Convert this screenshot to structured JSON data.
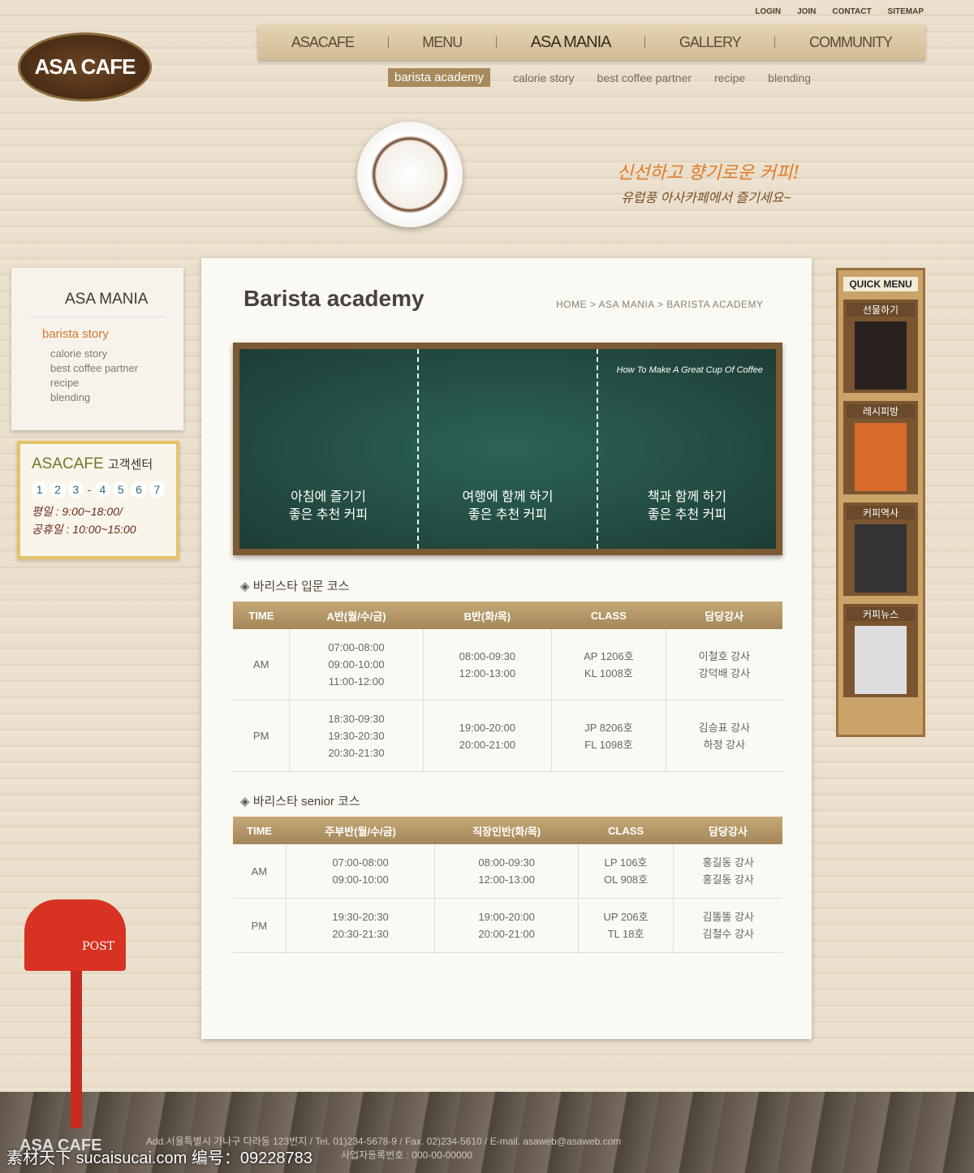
{
  "top_links": [
    "LOGIN",
    "JOIN",
    "CONTACT",
    "SITEMAP"
  ],
  "logo": "ASA CAFE",
  "nav": [
    "ASACAFE",
    "MENU",
    "ASA MANIA",
    "GALLERY",
    "COMMUNITY"
  ],
  "nav_active": "ASA MANIA",
  "subnav": [
    "barista academy",
    "calorie story",
    "best coffee partner",
    "recipe",
    "blending"
  ],
  "slogan": "신선하고 향기로운 커피!",
  "slogan2": "유럽풍 아사카페에서 즐기세요~",
  "sidebar": {
    "title": "ASA MANIA",
    "items": [
      "barista story",
      "calorie story",
      "best coffee partner",
      "recipe",
      "blending"
    ]
  },
  "customer_center": {
    "title": "ASACAFE",
    "subtitle": "고객센터",
    "digits": [
      "1",
      "2",
      "3",
      "-",
      "4",
      "5",
      "6",
      "7"
    ],
    "weekday": "평일 : 9:00~18:00/",
    "holiday": "공휴일 : 10:00~15:00"
  },
  "page_title": "Barista academy",
  "breadcrumb": "HOME > ASA MANIA > BARISTA ACADEMY",
  "board": {
    "heading": "How To Make A Great Cup Of Coffee",
    "panels": [
      [
        "아침에 즐기기",
        "좋은 추천 커피"
      ],
      [
        "여행에 함께 하기",
        "좋은 추천 커피"
      ],
      [
        "책과 함께 하기",
        "좋은 추천 커피"
      ]
    ]
  },
  "course1": {
    "title": "바리스타 입문 코스",
    "headers": [
      "TIME",
      "A반(월/수/금)",
      "B반(화/목)",
      "CLASS",
      "담당강사"
    ],
    "rows": [
      [
        "AM",
        "07:00-08:00\n09:00-10:00\n11:00-12:00",
        "08:00-09:30\n12:00-13:00",
        "AP 1206호\nKL 1008호",
        "이철호 강사\n강덕배 강사"
      ],
      [
        "PM",
        "18:30-09:30\n19:30-20:30\n20:30-21:30",
        "19:00-20:00\n20:00-21:00",
        "JP 8206호\nFL 1098호",
        "김승표 강사\n하정 강사"
      ]
    ]
  },
  "course2": {
    "title": "바리스타 senior 코스",
    "headers": [
      "TIME",
      "주부반(월/수/금)",
      "직장인반(화/목)",
      "CLASS",
      "담당강사"
    ],
    "rows": [
      [
        "AM",
        "07:00-08:00\n09:00-10:00",
        "08:00-09:30\n12:00-13:00",
        "LP 106호\nOL 908호",
        "홍길동 강사\n홍길동 강사"
      ],
      [
        "PM",
        "19:30-20:30\n20:30-21:30",
        "19:00-20:00\n20:00-21:00",
        "UP 206호\nTL 18호",
        "김똘똘 강사\n김철수 강사"
      ]
    ]
  },
  "quick_menu": {
    "title": "QUICK MENU",
    "items": [
      "선물하기",
      "레시피방",
      "커피역사",
      "커피뉴스"
    ]
  },
  "mailbox_label": "POST",
  "footer": {
    "logo": "ASA CAFE",
    "line1": "Add.서울특별시 가나구 다라동 123번지 / Tel. 01)234-5678-9 / Fax. 02)234-5610 / E-mail. asaweb@asaweb.com",
    "line2": "사업자등록번호 : 000-00-00000"
  },
  "watermark": "素材天下 sucaisucai.com 编号：09228783",
  "colors": {
    "accent": "#d8762a",
    "table_header": "#a48758",
    "board": "#1d3d36"
  }
}
